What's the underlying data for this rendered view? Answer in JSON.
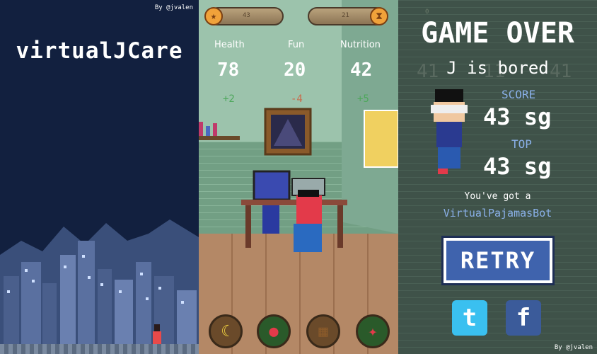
{
  "title_screen": {
    "credit": "By @jvalen",
    "title": "virtualJCare"
  },
  "game": {
    "coins": "43",
    "timer": "21",
    "stats": [
      {
        "label": "Health",
        "value": "78",
        "delta": "+2",
        "color": "#4ea85c"
      },
      {
        "label": "Fun",
        "value": "20",
        "delta": "-4",
        "color": "#c96a4a"
      },
      {
        "label": "Nutrition",
        "value": "42",
        "delta": "+5",
        "color": "#4ea85c"
      }
    ]
  },
  "game_over": {
    "title": "GAME OVER",
    "subtitle": "J is bored",
    "score_label": "SCORE",
    "score_value": "43 sg",
    "top_label": "TOP",
    "top_value": "43 sg",
    "reward_text": "You've got a",
    "reward_name": "VirtualPajamasBot",
    "retry_label": "RETRY",
    "credit": "By @jvalen",
    "bg_coins": "0",
    "bg_stats": [
      "41",
      "11",
      "41"
    ]
  }
}
